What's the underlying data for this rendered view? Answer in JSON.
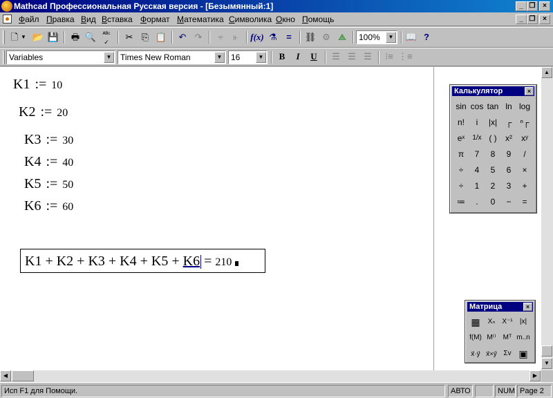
{
  "window": {
    "title": "Mathcad Профессиональная Русская версия - [Безымянный:1]"
  },
  "menu": [
    "Файл",
    "Правка",
    "Вид",
    "Вставка",
    "Формат",
    "Математика",
    "Символика",
    "Окно",
    "Помощь"
  ],
  "toolbar": {
    "zoom": "100%",
    "icons": [
      "new-icon",
      "open-icon",
      "save-icon",
      "print-icon",
      "print-preview-icon",
      "spell-check-icon",
      "cut-icon",
      "copy-icon",
      "paste-icon",
      "undo-icon",
      "redo-icon",
      "align-top-icon",
      "align-left-icon",
      "insert-function-icon",
      "insert-unit-icon",
      "calculate-icon",
      "insert-component-icon",
      "resource-icon",
      "graph-icon",
      "resource-center-icon",
      "help-icon"
    ]
  },
  "format_bar": {
    "style": "Variables",
    "font": "Times New Roman",
    "size": "16",
    "bold": "B",
    "italic": "I",
    "underline": "U"
  },
  "worksheet": {
    "assign_op": ":=",
    "definitions": [
      {
        "name": "K1",
        "value": "10"
      },
      {
        "name": "K2",
        "value": "20"
      },
      {
        "name": "K3",
        "value": "30"
      },
      {
        "name": "K4",
        "value": "40"
      },
      {
        "name": "K5",
        "value": "50"
      },
      {
        "name": "K6",
        "value": "60"
      }
    ],
    "sum_expression": "K1 + K2 + K3 + K4 + K5 + ",
    "sum_last_term": "K6",
    "eval_op": "=",
    "sum_result": "210"
  },
  "calculator": {
    "title": "Калькулятор",
    "keys": [
      [
        "sin",
        "cos",
        "tan",
        "ln",
        "log"
      ],
      [
        "n!",
        "i",
        "|x|",
        "┌",
        "ⁿ┌"
      ],
      [
        "eˣ",
        "1/x",
        "( )",
        "x²",
        "xʸ"
      ],
      [
        "π",
        "7",
        "8",
        "9",
        "/"
      ],
      [
        "÷",
        "4",
        "5",
        "6",
        "×"
      ],
      [
        "÷",
        "1",
        "2",
        "3",
        "+"
      ],
      [
        "≔",
        ".",
        "0",
        "−",
        "="
      ]
    ]
  },
  "matrix": {
    "title": "Матрица",
    "keys": [
      [
        "▦",
        "Xₙ",
        "X⁻¹",
        "|x|"
      ],
      [
        "f(M)",
        "M⁽⁾",
        "Mᵀ",
        "m..n"
      ],
      [
        "x⃗·y⃗",
        "x⃗×y⃗",
        "Σv",
        "▣"
      ]
    ]
  },
  "status": {
    "hint": "Исп F1 для Помощи.",
    "mode": "АВТО",
    "num": "NUM",
    "page": "Page 2"
  }
}
